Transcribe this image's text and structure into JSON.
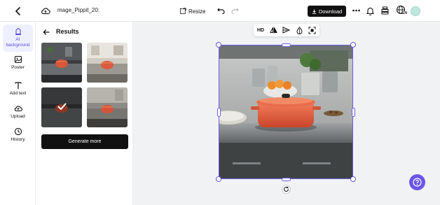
{
  "topbar": {
    "filename": "mage_Pippit_20:",
    "resize_label": "Resize",
    "download_label": "Download",
    "lang_badge": "EN"
  },
  "rail": {
    "items": [
      {
        "label_line1": "AI",
        "label_line2": "background",
        "icon": "ai-background-icon"
      },
      {
        "label_line1": "Poster",
        "icon": "poster-icon"
      },
      {
        "label_line1": "Add text",
        "icon": "text-icon"
      },
      {
        "label_line1": "Upload",
        "icon": "upload-icon"
      },
      {
        "label_line1": "History",
        "icon": "history-icon"
      }
    ]
  },
  "panel": {
    "title": "Results",
    "generate_label": "Generate more",
    "selected_index": 2
  },
  "floatbar": {
    "hd_label": "HD"
  },
  "colors": {
    "accent": "#6b5ce7",
    "help_bg": "#6b55e8",
    "dark_button": "#111111",
    "canvas_bg": "#f1f2f4"
  }
}
